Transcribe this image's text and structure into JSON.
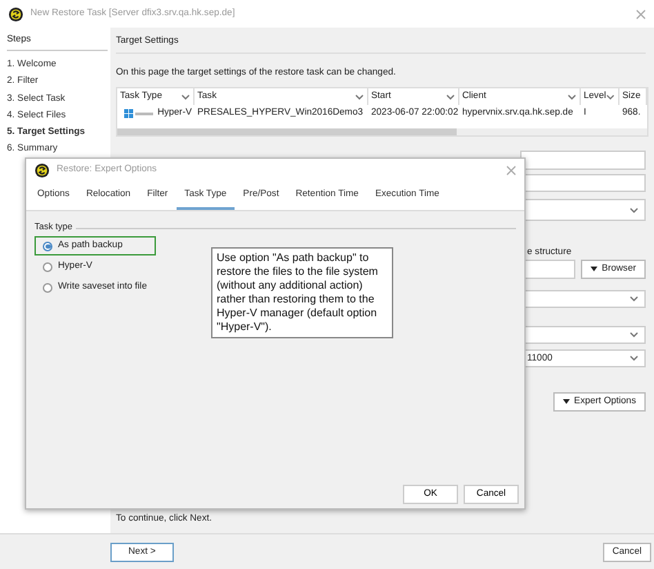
{
  "window": {
    "title": "New Restore Task [Server dfix3.srv.qa.hk.sep.de]"
  },
  "steps": {
    "heading": "Steps",
    "items": [
      {
        "label": "1. Welcome",
        "selected": false
      },
      {
        "label": "2. Filter",
        "selected": false
      },
      {
        "label": "3. Select Task",
        "selected": false
      },
      {
        "label": "4. Select Files",
        "selected": false
      },
      {
        "label": "5. Target Settings",
        "selected": true
      },
      {
        "label": "6. Summary",
        "selected": false
      }
    ]
  },
  "page": {
    "heading": "Target Settings",
    "description": "On this page the target settings of the restore task can be changed.",
    "table": {
      "columns": [
        "Task Type",
        "Task",
        "Start",
        "Client",
        "Level",
        "Size"
      ],
      "rows": [
        {
          "cells": [
            "Hyper-V",
            "PRESALES_HYPERV_Win2016Demo3",
            "2023-06-07 22:00:02",
            "hypervnix.srv.qa.hk.sep.de",
            "I",
            "968."
          ]
        }
      ]
    },
    "form": [
      {
        "kind": "text"
      },
      {
        "kind": "text"
      },
      {
        "kind": "dropdown"
      },
      {
        "kind": "label",
        "text": "e structure"
      },
      {
        "kind": "browse",
        "button": "Browser"
      },
      {
        "kind": "dropdown"
      },
      {
        "kind": "dropdown"
      },
      {
        "kind": "dropdown",
        "value": "11000"
      },
      {
        "kind": "expert",
        "button": "Expert Options"
      }
    ],
    "hint": "To continue, click Next."
  },
  "footer": {
    "buttons": [
      "Next >",
      "Cancel"
    ]
  },
  "dialog": {
    "title": "Restore: Expert Options",
    "tabs": [
      {
        "label": "Options",
        "selected": false
      },
      {
        "label": "Relocation",
        "selected": false
      },
      {
        "label": "Filter",
        "selected": false
      },
      {
        "label": "Task Type",
        "selected": true
      },
      {
        "label": "Pre/Post",
        "selected": false
      },
      {
        "label": "Retention Time",
        "selected": false
      },
      {
        "label": "Execution Time",
        "selected": false
      }
    ],
    "group": "Task type",
    "options": [
      {
        "label": "As path backup",
        "selected": true,
        "highlighted": true
      },
      {
        "label": "Hyper-V",
        "selected": false,
        "highlighted": false
      },
      {
        "label": "Write saveset into file",
        "selected": false,
        "highlighted": false
      }
    ],
    "tooltip": "Use option \"As path backup\" to restore the files to the file system (without any additional action) rather than restoring them to the Hyper-V manager (default option \"Hyper-V\").",
    "buttons": [
      "OK",
      "Cancel"
    ]
  }
}
